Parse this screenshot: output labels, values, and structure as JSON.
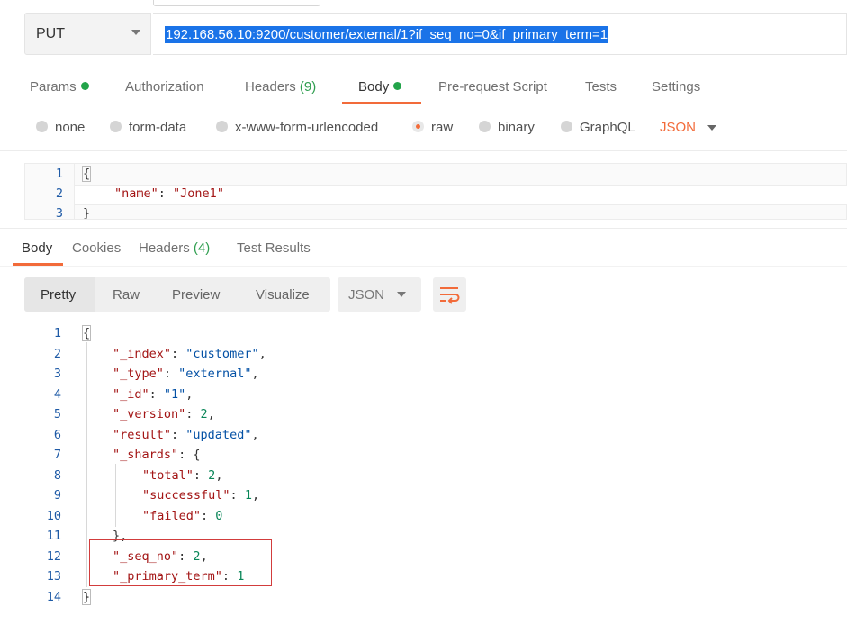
{
  "request": {
    "method": "PUT",
    "url": "192.168.56.10:9200/customer/external/1?if_seq_no=0&if_primary_term=1"
  },
  "request_tabs": [
    {
      "label": "Params",
      "dot": true
    },
    {
      "label": "Authorization"
    },
    {
      "label": "Headers",
      "count": "(9)"
    },
    {
      "label": "Body",
      "dot": true,
      "active": true
    },
    {
      "label": "Pre-request Script"
    },
    {
      "label": "Tests"
    },
    {
      "label": "Settings"
    }
  ],
  "body_types": [
    "none",
    "form-data",
    "x-www-form-urlencoded",
    "raw",
    "binary",
    "GraphQL"
  ],
  "body_type_selected": "raw",
  "body_format": "JSON",
  "request_body": {
    "line_numbers": [
      "1",
      "2",
      "3"
    ],
    "line1": "{",
    "line2_key": "\"name\"",
    "line2_sep": ": ",
    "line2_value": "\"Jone1\"",
    "line3": "}"
  },
  "response_tabs": [
    {
      "label": "Body",
      "active": true
    },
    {
      "label": "Cookies"
    },
    {
      "label": "Headers",
      "count": "(4)"
    },
    {
      "label": "Test Results"
    }
  ],
  "view_modes": [
    "Pretty",
    "Raw",
    "Preview",
    "Visualize"
  ],
  "view_mode_selected": "Pretty",
  "response_format": "JSON",
  "response_body": {
    "line_numbers": [
      "1",
      "2",
      "3",
      "4",
      "5",
      "6",
      "7",
      "8",
      "9",
      "10",
      "11",
      "12",
      "13",
      "14"
    ],
    "index_key": "\"_index\"",
    "index_value": "\"customer\"",
    "type_key": "\"_type\"",
    "type_value": "\"external\"",
    "id_key": "\"_id\"",
    "id_value": "\"1\"",
    "version_key": "\"_version\"",
    "version_value": "2",
    "result_key": "\"result\"",
    "result_value": "\"updated\"",
    "shards_key": "\"_shards\"",
    "total_key": "\"total\"",
    "total_value": "2",
    "successful_key": "\"successful\"",
    "successful_value": "1",
    "failed_key": "\"failed\"",
    "failed_value": "0",
    "seq_no_key": "\"_seq_no\"",
    "seq_no_value": "2",
    "primary_term_key": "\"_primary_term\"",
    "primary_term_value": "1"
  },
  "colors": {
    "accent": "#f26b3a",
    "dot_green": "#23a44a",
    "url_highlight": "#1a73e8",
    "highlight_box": "#d23c3c"
  }
}
